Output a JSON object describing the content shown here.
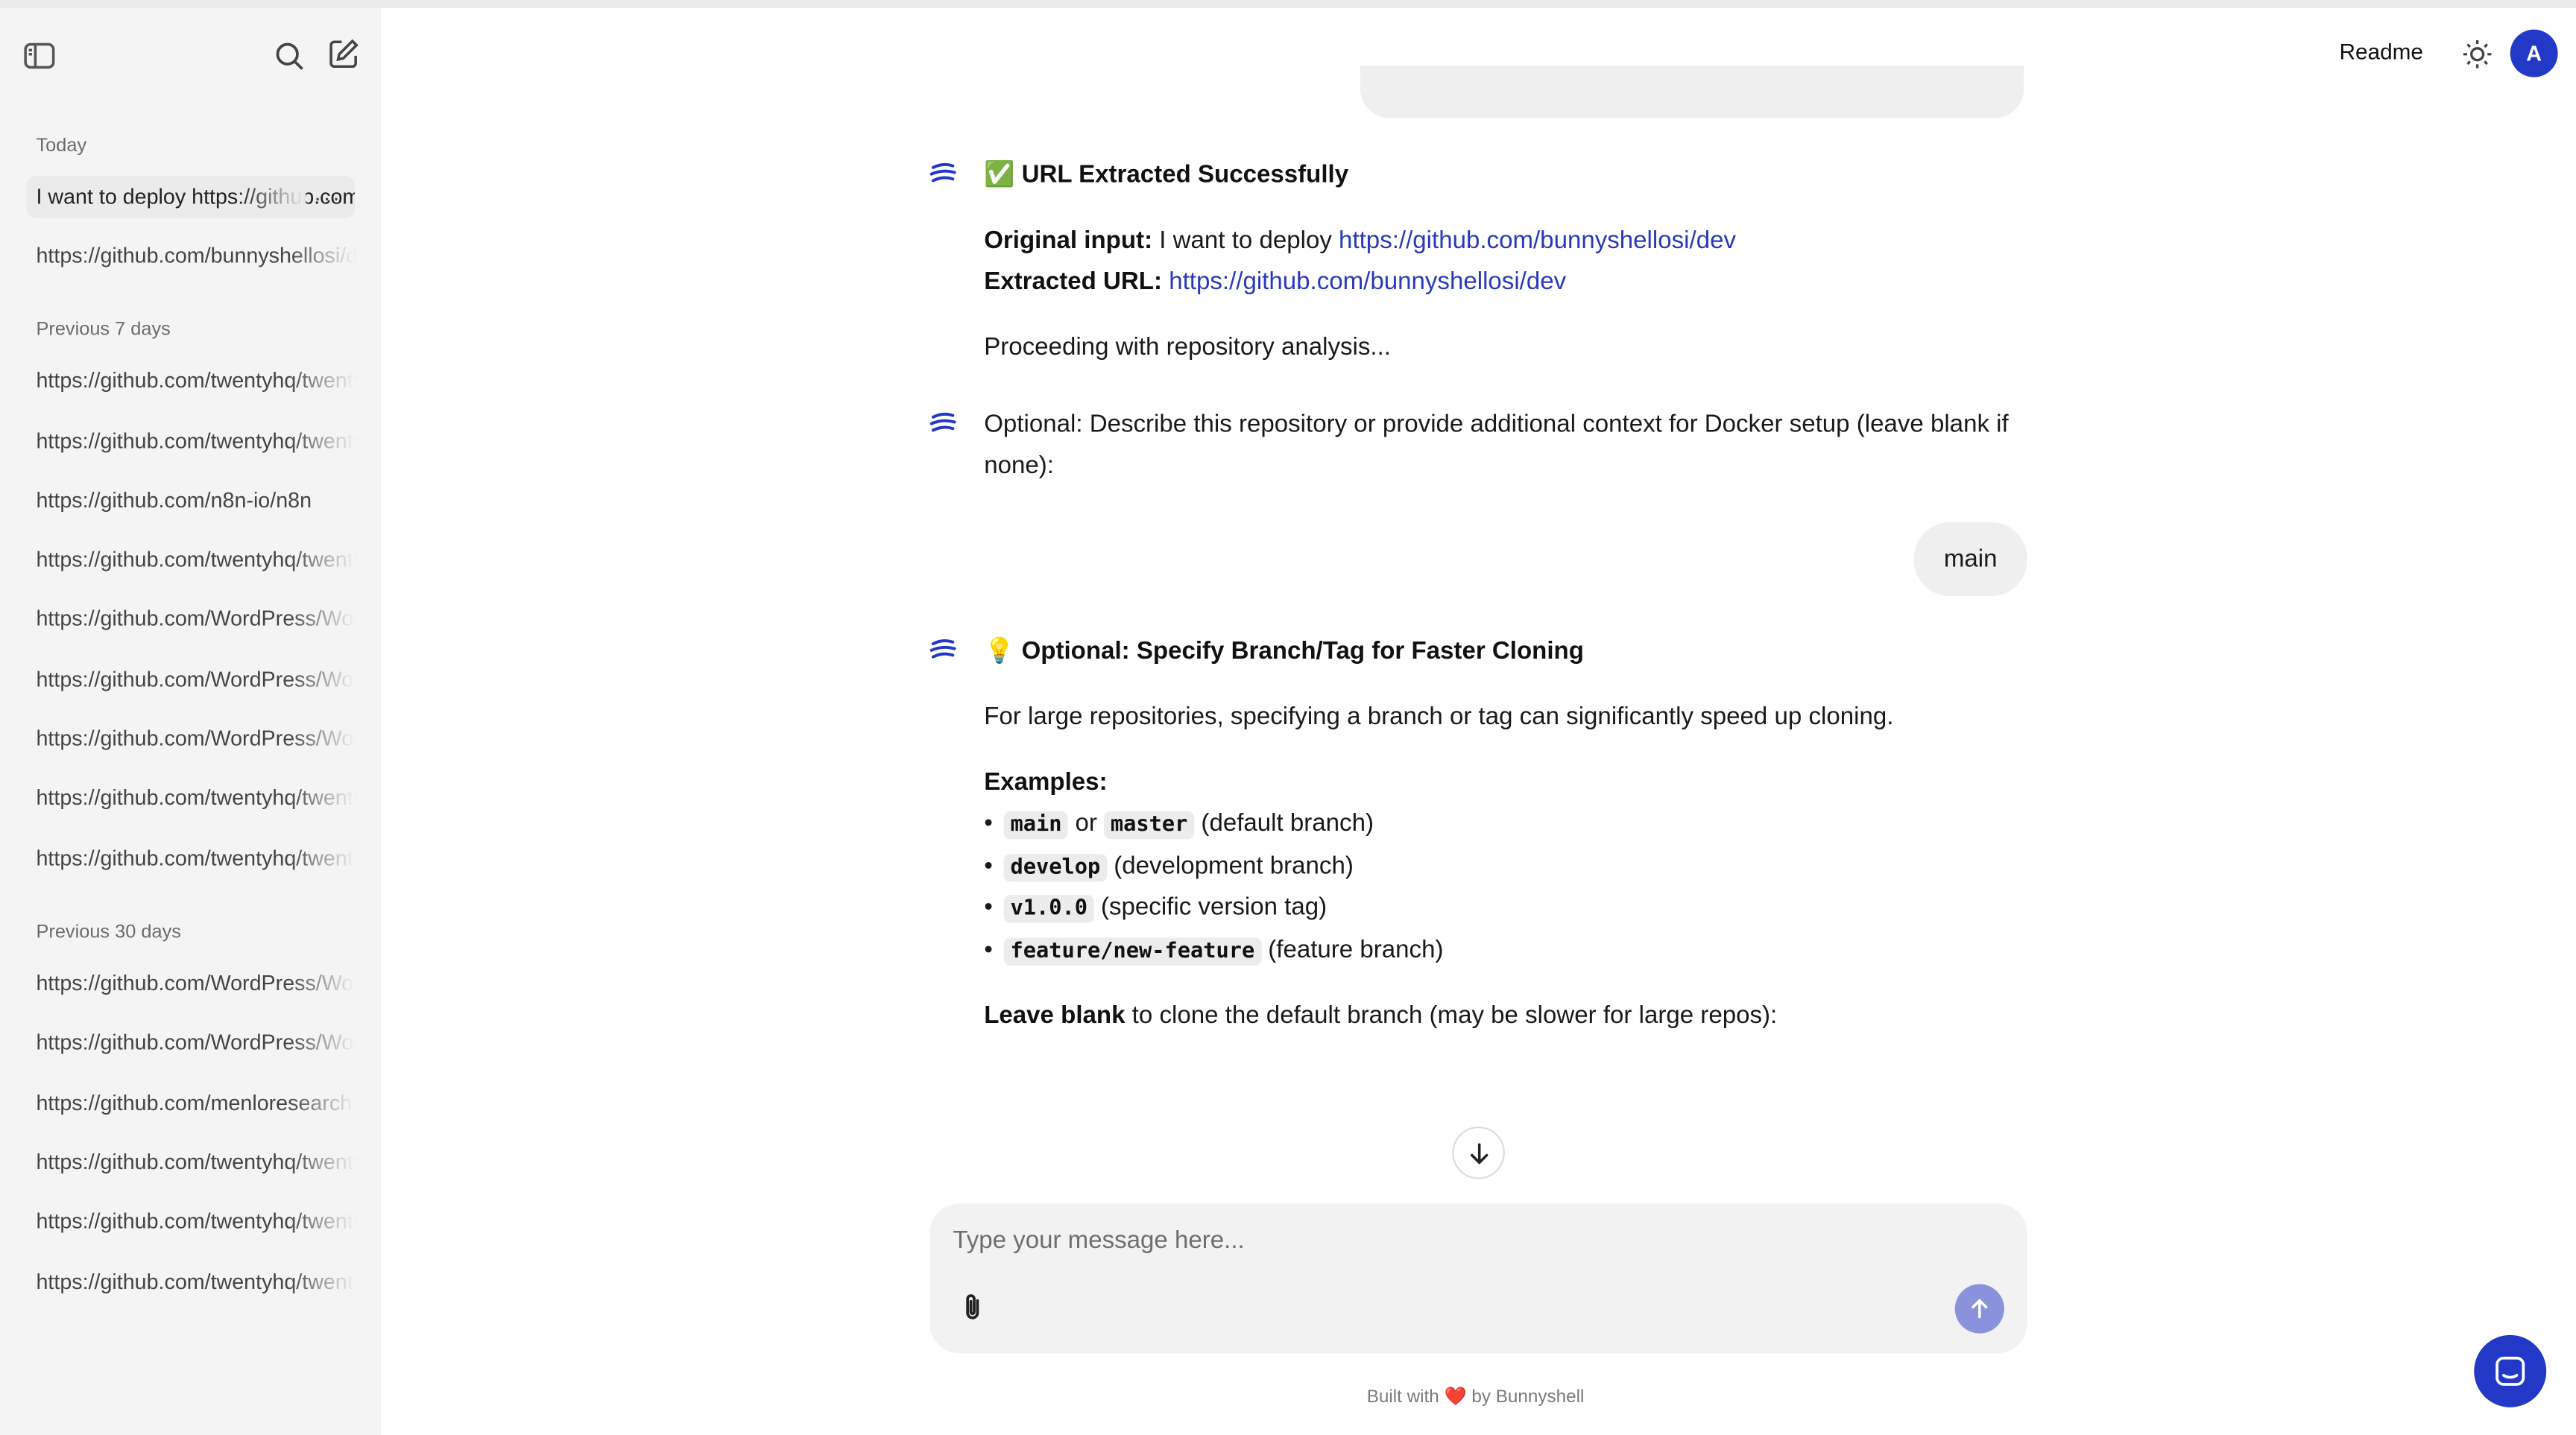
{
  "sidebar": {
    "sections": {
      "today": "Today",
      "prev7": "Previous 7 days",
      "prev30": "Previous 30 days"
    },
    "today_items": [
      "I want to deploy https://github.com/bunnyshellosi/dev",
      "https://github.com/bunnyshellosi/dev"
    ],
    "more_label": "···",
    "prev7_items": [
      "https://github.com/twentyhq/twenty",
      "https://github.com/twentyhq/twenty",
      "https://github.com/n8n-io/n8n",
      "https://github.com/twentyhq/twenty",
      "https://github.com/WordPress/WordPress",
      "https://github.com/WordPress/WordPress",
      "https://github.com/WordPress/WordPress",
      "https://github.com/twentyhq/twenty",
      "https://github.com/twentyhq/twenty"
    ],
    "prev30_items": [
      "https://github.com/WordPress/WordPress",
      "https://github.com/WordPress/WordPress",
      "https://github.com/menloresearch",
      "https://github.com/twentyhq/twenty",
      "https://github.com/twentyhq/twenty",
      "https://github.com/twentyhq/twenty"
    ]
  },
  "header": {
    "readme": "Readme",
    "avatar_initial": "A"
  },
  "chat": {
    "msg1": {
      "emoji": "✅",
      "title": "URL Extracted Successfully",
      "original_label": "Original input:",
      "original_text": "I want to deploy ",
      "original_link": "https://github.com/bunnyshellosi/dev",
      "extracted_label": "Extracted URL:",
      "extracted_link": "https://github.com/bunnyshellosi/dev",
      "proceeding": "Proceeding with repository analysis..."
    },
    "msg2": {
      "text": "Optional: Describe this repository or provide additional context for Docker setup (leave blank if none):"
    },
    "user_reply": "main",
    "msg3": {
      "emoji": "💡",
      "title": "Optional: Specify Branch/Tag for Faster Cloning",
      "intro": "For large repositories, specifying a branch or tag can significantly speed up cloning.",
      "examples_label": "Examples:",
      "ex1_code_a": "main",
      "ex1_or": "or",
      "ex1_code_b": "master",
      "ex1_desc": "(default branch)",
      "ex2_code": "develop",
      "ex2_desc": "(development branch)",
      "ex3_code": "v1.0.0",
      "ex3_desc": "(specific version tag)",
      "ex4_code": "feature/new-feature",
      "ex4_desc": "(feature branch)",
      "leave_blank_bold": "Leave blank",
      "leave_blank_rest": " to clone the default branch (may be slower for large repos):"
    }
  },
  "composer": {
    "placeholder": "Type your message here..."
  },
  "footer": {
    "prefix": "Built with ",
    "heart": "❤️",
    "suffix": " by Bunnyshell"
  },
  "colors": {
    "accent": "#2438c8",
    "link": "#2a3ab8",
    "send_button": "#8a92dc",
    "sidebar_bg": "#f4f4f4"
  }
}
